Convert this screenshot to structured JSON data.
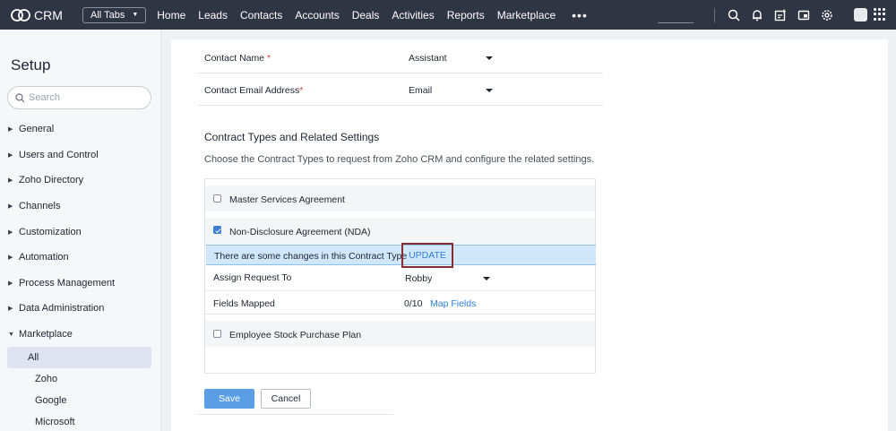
{
  "app": {
    "name": "CRM",
    "all_tabs_label": "All Tabs"
  },
  "nav": [
    "Home",
    "Leads",
    "Contacts",
    "Accounts",
    "Deals",
    "Activities",
    "Reports",
    "Marketplace"
  ],
  "nav_more": "•••",
  "top_icons": [
    "search-icon",
    "bell-icon",
    "calendar-add-icon",
    "video-icon",
    "gear-icon"
  ],
  "sidebar": {
    "title": "Setup",
    "search_placeholder": "Search",
    "items": [
      {
        "label": "General",
        "arrow": "▶"
      },
      {
        "label": "Users and Control",
        "arrow": "▶"
      },
      {
        "label": "Zoho Directory",
        "arrow": "▶"
      },
      {
        "label": "Channels",
        "arrow": "▶"
      },
      {
        "label": "Customization",
        "arrow": "▶"
      },
      {
        "label": "Automation",
        "arrow": "▶"
      },
      {
        "label": "Process Management",
        "arrow": "▶"
      },
      {
        "label": "Data Administration",
        "arrow": "▶"
      },
      {
        "label": "Marketplace",
        "arrow": "▼"
      }
    ],
    "marketplace_sub": [
      "All",
      "Zoho",
      "Google",
      "Microsoft"
    ],
    "active_sub": "All"
  },
  "form": {
    "contact_name": {
      "label": "Contact Name",
      "required": "*",
      "value": "Assistant"
    },
    "contact_email": {
      "label": "Contact Email Address",
      "required": "*",
      "value": "Email"
    }
  },
  "contract_section": {
    "title": "Contract Types and Related Settings",
    "description": "Choose the Contract Types to request from Zoho CRM and configure the related settings.",
    "types": [
      {
        "label": "Master Services Agreement",
        "checked": false
      },
      {
        "label": "Non-Disclosure Agreement (NDA)",
        "checked": true
      },
      {
        "label": "Employee Stock Purchase Plan",
        "checked": false
      }
    ],
    "notice": "There are some changes in this Contract Type",
    "update_label": "UPDATE",
    "assign_label": "Assign Request To",
    "assign_value": "Robby",
    "fields_label": "Fields Mapped",
    "fields_value": "0/10",
    "map_fields_label": "Map Fields"
  },
  "buttons": {
    "save": "Save",
    "cancel": "Cancel"
  },
  "colors": {
    "topbar": "#2f3543",
    "accent": "#2f7fd6",
    "notice_bg": "#cfe6fb",
    "save_bg": "#5a9fe6",
    "highlight_border": "#8a2a32"
  }
}
